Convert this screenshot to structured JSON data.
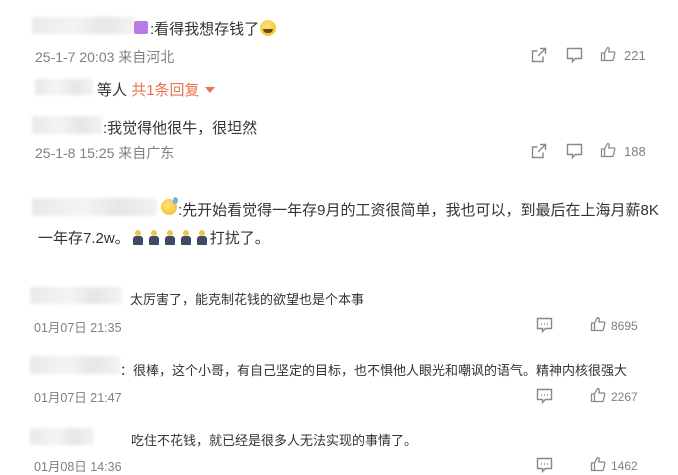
{
  "comments": [
    {
      "text": ":看得我想存钱了",
      "time": "25-1-7 20:03",
      "location": "来自河北",
      "likes": "221"
    },
    {
      "reply_prefix": "等人",
      "reply_link": "共1条回复"
    },
    {
      "text": ":我觉得他很牛，很坦然",
      "time": "25-1-8 15:25",
      "location": "来自广东",
      "likes": "188"
    },
    {
      "text_line1": ":先开始看觉得一年存9月的工资很简单，我也可以，到最后在上海月薪8K",
      "text_line2_a": "一年存7.2w。",
      "text_line2_b": "打扰了。"
    },
    {
      "text": "太厉害了，能克制花钱的欲望也是个本事",
      "time": "01月07日 21:35",
      "likes": "8695"
    },
    {
      "text": "：很棒，这个小哥，有自己坚定的目标，也不惧他人眼光和嘲讽的语气。精神内核很强大",
      "time": "01月07日 21:47",
      "likes": "2267"
    },
    {
      "text": "吃住不花钱，就已经是很多人无法实现的事情了。",
      "time": "01月08日 14:36",
      "likes": "1462"
    }
  ],
  "icons": {
    "share": "share-icon",
    "comment": "comment-icon",
    "like": "thumbs-up-icon",
    "badge": "member-badge-icon",
    "emoji": "emoji-icon"
  }
}
